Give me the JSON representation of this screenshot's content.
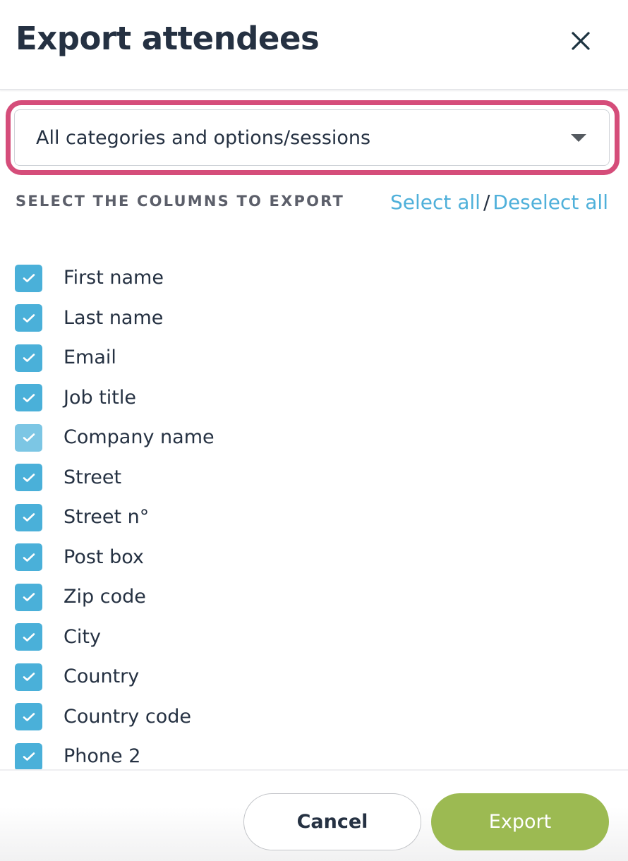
{
  "dialog": {
    "title": "Export attendees",
    "close_icon": "close-icon"
  },
  "filter": {
    "selected": "All categories and options/sessions",
    "highlight_color": "#d54d7a"
  },
  "columns_section": {
    "heading": "SELECT THE COLUMNS TO EXPORT",
    "select_all": "Select all",
    "separator": "/",
    "deselect_all": "Deselect all"
  },
  "columns": [
    {
      "label": "First name",
      "checked": true,
      "hover": false
    },
    {
      "label": "Last name",
      "checked": true,
      "hover": false
    },
    {
      "label": "Email",
      "checked": true,
      "hover": false
    },
    {
      "label": "Job title",
      "checked": true,
      "hover": false
    },
    {
      "label": "Company name",
      "checked": true,
      "hover": true
    },
    {
      "label": "Street",
      "checked": true,
      "hover": false
    },
    {
      "label": "Street n°",
      "checked": true,
      "hover": false
    },
    {
      "label": "Post box",
      "checked": true,
      "hover": false
    },
    {
      "label": "Zip code",
      "checked": true,
      "hover": false
    },
    {
      "label": "City",
      "checked": true,
      "hover": false
    },
    {
      "label": "Country",
      "checked": true,
      "hover": false
    },
    {
      "label": "Country code",
      "checked": true,
      "hover": false
    },
    {
      "label": "Phone 2",
      "checked": true,
      "hover": false
    }
  ],
  "footer": {
    "cancel_label": "Cancel",
    "export_label": "Export"
  },
  "colors": {
    "checkbox": "#4ab0d9",
    "checkbox_hover": "#7cc6e4",
    "link": "#4fb0da",
    "export_button": "#9cba52"
  }
}
